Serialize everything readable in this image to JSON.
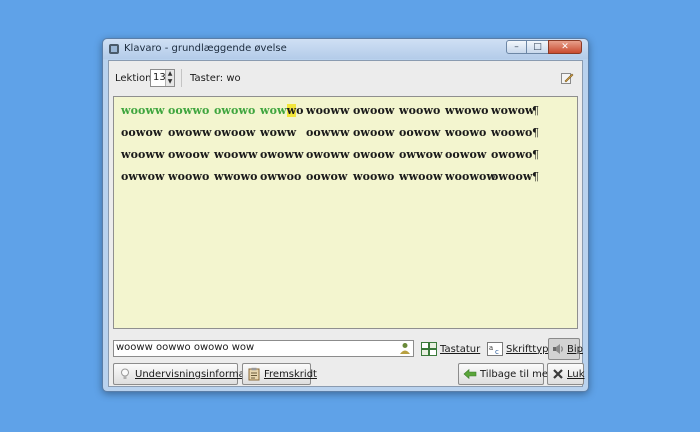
{
  "window": {
    "title": "Klavaro - grundlæggende øvelse"
  },
  "titlebar_buttons": {
    "minimize": "–",
    "maximize": "□",
    "close": "✕"
  },
  "toolbar": {
    "lesson_label": "Lektion:",
    "lesson_value": "13",
    "keys_label": "Taster: wo"
  },
  "exercise": {
    "typed_words": [
      "wooww",
      "oowwo",
      "owowo"
    ],
    "current_word_typed": "wow",
    "current_char": "w",
    "current_word_rest": "o",
    "line1_rest": [
      "wooww",
      "owoow",
      "woowo",
      "wwowo",
      "wowow"
    ],
    "line2": [
      "oowow",
      "owoww",
      "owoow",
      "woww",
      "oowww",
      "owoow",
      "oowow",
      "woowo",
      "woowo"
    ],
    "line3": [
      "wooww",
      "owoow",
      "wooww",
      "owoww",
      "owoww",
      "owoow",
      "owwow",
      "oowow",
      "owowo"
    ],
    "line4": [
      "owwow",
      "woowo",
      "wwowo",
      "owwoo",
      "oowow",
      "woowo",
      "wwoow",
      "woowow",
      "owoow"
    ],
    "pilcrow": "¶"
  },
  "input": {
    "value": "wooww oowwo owowo wow"
  },
  "input_toolbar": {
    "keyboard_label": "Tastatur",
    "font_label": "Skrifttype",
    "beep_label": "Bip"
  },
  "bottom": {
    "info_label": "Undervisningsinformation",
    "progress_label": "Fremskridt",
    "back_label": "Tilbage til menu",
    "close_label": "Luk"
  }
}
